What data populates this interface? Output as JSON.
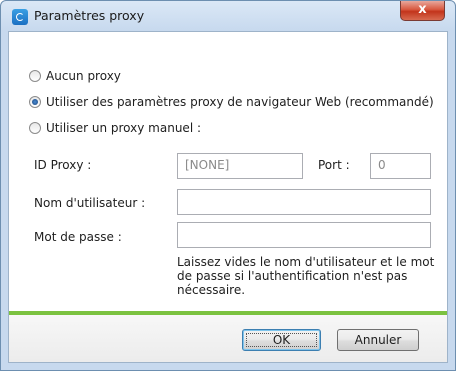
{
  "window": {
    "title": "Paramètres proxy",
    "close_glyph": "x"
  },
  "options": {
    "no_proxy": {
      "label": "Aucun proxy",
      "checked": false
    },
    "browser_proxy": {
      "label": "Utiliser des paramètres proxy de navigateur Web (recommandé)",
      "checked": true
    },
    "manual_proxy": {
      "label": "Utiliser un proxy manuel :",
      "checked": false
    }
  },
  "form": {
    "proxy_id_label": "ID Proxy :",
    "proxy_id_value": "[NONE]",
    "port_label": "Port :",
    "port_value": "0",
    "username_label": "Nom d'utilisateur :",
    "username_value": "",
    "password_label": "Mot de passe :",
    "password_value": "",
    "hint": "Laissez vides le nom d'utilisateur et le mot de passe si l'authentification n'est pas nécessaire."
  },
  "buttons": {
    "ok": "OK",
    "cancel": "Annuler"
  },
  "colors": {
    "accent_bar": "#7bc240",
    "close_button": "#c2341b"
  },
  "icons": {
    "app": "proxy-app-icon",
    "close": "close-icon"
  }
}
